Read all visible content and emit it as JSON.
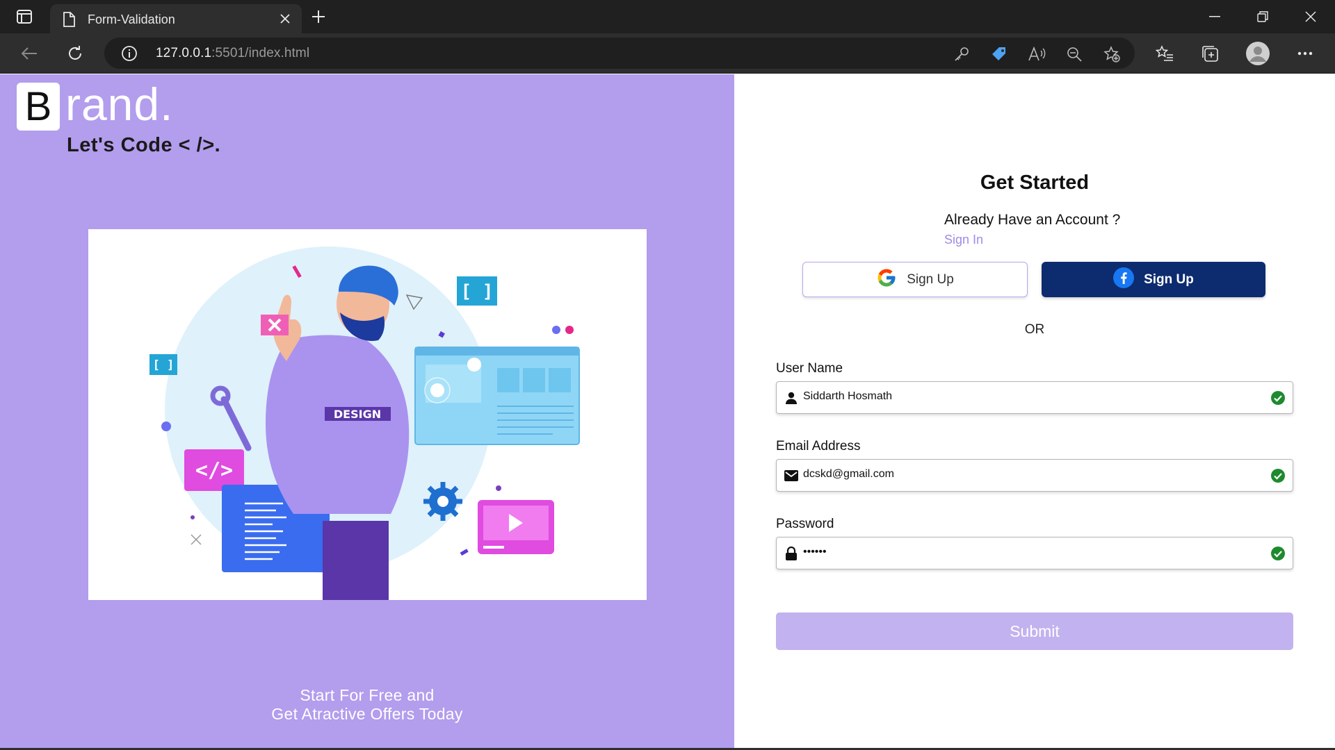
{
  "browser": {
    "tab_title": "Form-Validation",
    "url_host": "127.0.0.1",
    "url_rest": ":5501/index.html"
  },
  "left_panel": {
    "logo_letter": "B",
    "logo_rest": "rand.",
    "tagline": "Let's Code < />.",
    "illustration_label": "DESIGN",
    "promo_line1": "Start For Free and",
    "promo_line2": "Get Atractive Offers Today",
    "background_color": "#b39ded"
  },
  "form": {
    "title": "Get Started",
    "have_account": "Already Have an Account ?",
    "sign_in_link": "Sign In",
    "google_button": "Sign Up",
    "facebook_button": "Sign Up",
    "or_text": "OR",
    "fields": [
      {
        "label": "User Name",
        "value": "Siddarth Hosmath",
        "icon": "user-icon",
        "valid": true
      },
      {
        "label": "Email Address",
        "value": "dcskd@gmail.com",
        "icon": "envelope-icon",
        "valid": true
      },
      {
        "label": "Password",
        "value": "••••••",
        "icon": "lock-icon",
        "valid": true
      }
    ],
    "submit_label": "Submit",
    "accent_color": "#a38ae6",
    "facebook_color": "#0d2b6f",
    "valid_color": "#1e8a2e"
  }
}
